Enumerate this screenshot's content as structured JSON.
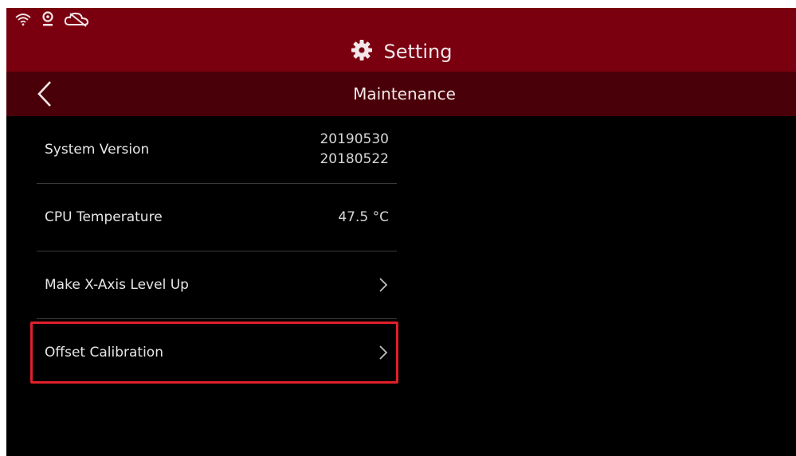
{
  "header": {
    "title": "Setting"
  },
  "subheader": {
    "title": "Maintenance"
  },
  "status_icons": [
    "wifi-icon",
    "webcam-icon",
    "cloud-disconnected-icon"
  ],
  "maintenance": {
    "system_version": {
      "label": "System Version",
      "values": [
        "20190530",
        "20180522"
      ]
    },
    "cpu_temperature": {
      "label": "CPU Temperature",
      "value": "47.5 °C"
    },
    "x_axis_level_up": {
      "label": "Make X-Axis Level Up"
    },
    "offset_calibration": {
      "label": "Offset Calibration"
    }
  },
  "colors": {
    "header": "#7a0010",
    "subheader": "#4a0008",
    "background": "#000000",
    "highlight": "#e0202a"
  }
}
